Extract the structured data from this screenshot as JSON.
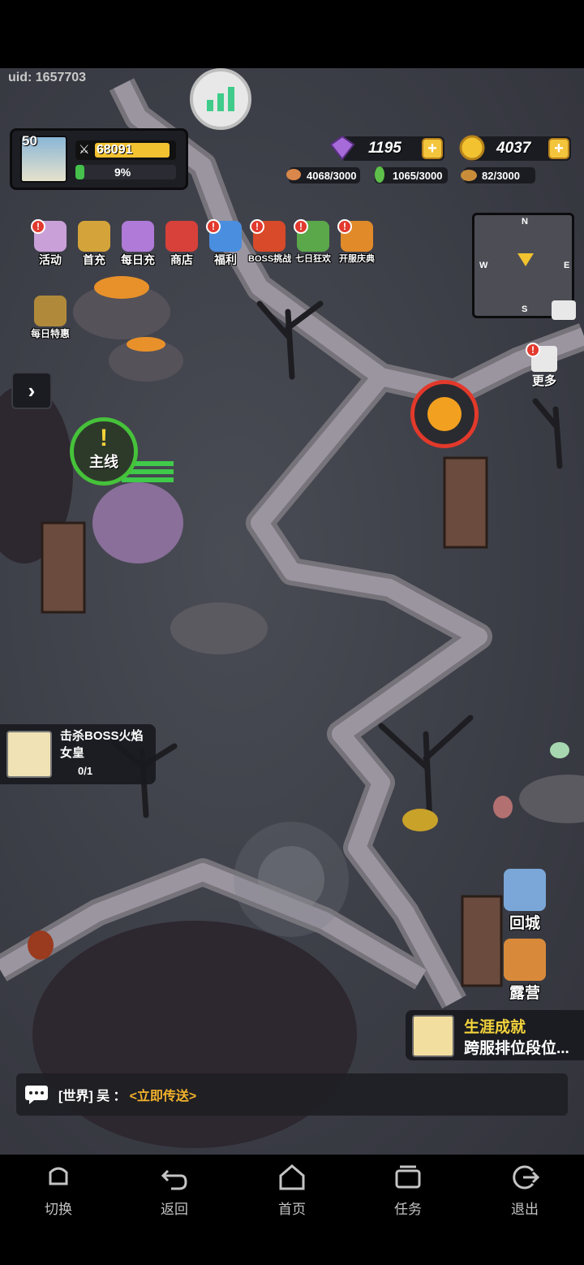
{
  "uid": "uid: 1657703",
  "player": {
    "level": "50",
    "power": "68091",
    "exp_percent": "9%",
    "exp_fraction": 0.09
  },
  "currencies": {
    "gems": "1195",
    "gold": "4037",
    "meat": "4068/3000",
    "herb": "1065/3000",
    "ore": "82/3000"
  },
  "menu": [
    {
      "label": "活动",
      "icon": "activity-icon",
      "badge": "!"
    },
    {
      "label": "首充",
      "icon": "first-recharge-icon",
      "badge": ""
    },
    {
      "label": "每日充",
      "icon": "daily-recharge-icon",
      "badge": ""
    },
    {
      "label": "商店",
      "icon": "shop-icon",
      "badge": ""
    },
    {
      "label": "福利",
      "icon": "welfare-gift-icon",
      "badge": "!"
    },
    {
      "label": "BOSS挑战",
      "icon": "boss-challenge-icon",
      "badge": "!"
    },
    {
      "label": "七日狂欢",
      "icon": "seven-day-carnival-icon",
      "badge": "!"
    },
    {
      "label": "开服庆典",
      "icon": "server-celebration-icon",
      "badge": "!"
    }
  ],
  "daily_deal": "每日特惠",
  "minimap": {
    "n": "N",
    "s": "S",
    "e": "E",
    "w": "W"
  },
  "more": "更多",
  "quest_marker": {
    "bang": "!",
    "label": "主线"
  },
  "task": {
    "title": "击杀BOSS火焰女皇",
    "progress": "0/1"
  },
  "return_city": "回城",
  "camp": "露营",
  "achievement": {
    "title": "生涯成就",
    "subtitle": "跨服排位段位..."
  },
  "chat": {
    "channel": "[世界] 吴 ：",
    "link": "<立即传送>"
  },
  "nav": [
    {
      "label": "切换",
      "icon": "switch-icon"
    },
    {
      "label": "返回",
      "icon": "back-icon"
    },
    {
      "label": "首页",
      "icon": "home-icon"
    },
    {
      "label": "任务",
      "icon": "task-icon"
    },
    {
      "label": "退出",
      "icon": "exit-icon"
    }
  ],
  "colors": {
    "accent_gold": "#f3c53c",
    "quest_green": "#46c23a",
    "boss_red": "#e2392b",
    "link_orange": "#f3b32c"
  }
}
